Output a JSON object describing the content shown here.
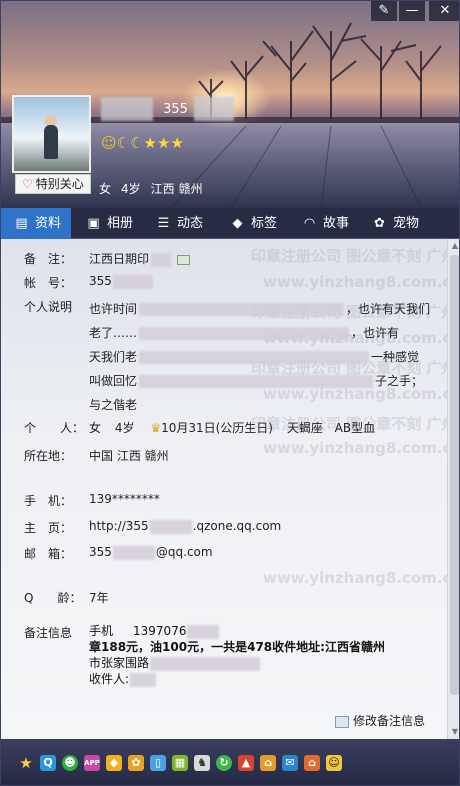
{
  "window_buttons": {
    "skin": "✎",
    "minimize": "—",
    "close": "✕"
  },
  "profile": {
    "nickname_visible": "355",
    "special_care": "特别关心",
    "gender": "女",
    "age": "4岁",
    "province": "江西",
    "city": "赣州",
    "level_icons": [
      "sun-icon",
      "moon-icon",
      "moon-icon",
      "star-icon",
      "star-icon",
      "star-icon"
    ]
  },
  "tabs": [
    {
      "label": "资料",
      "icon": "profile-card-icon"
    },
    {
      "label": "相册",
      "icon": "album-icon"
    },
    {
      "label": "动态",
      "icon": "feed-icon"
    },
    {
      "label": "标签",
      "icon": "tag-icon"
    },
    {
      "label": "故事",
      "icon": "story-icon"
    },
    {
      "label": "宠物",
      "icon": "pet-icon"
    }
  ],
  "watermarks": [
    "www.yinzhang8.com.cn",
    "印章注册公司 图公章不刻 广州",
    "www.yinzhang8.com.cn",
    "印章注册公司 图公章不刻 广州",
    "www.yinzhang8.com.cn",
    "印章注册公司 图公章不刻 广州",
    "www.yinzhang8.com.cn",
    "印章注册公司 图公章不刻 广州",
    "www.yinzhang8.com.cn"
  ],
  "fields": {
    "remark": {
      "label": "备　注：",
      "value": "江西日期印"
    },
    "account": {
      "label": "帐　号：",
      "value": "355"
    },
    "bio": {
      "label": "个人说明",
      "lines": [
        [
          "也许时间",
          "",
          "，也许有天我们"
        ],
        [
          "老了……",
          "",
          "，也许有"
        ],
        [
          "天我们老",
          "",
          "一种感觉"
        ],
        [
          "叫做回忆",
          "",
          "子之手；"
        ],
        [
          "与之偕老",
          "",
          ""
        ]
      ]
    },
    "personal": {
      "label": "个　　人：",
      "gender": "女",
      "age": "4岁",
      "birthday": "10月31日(公历生日)",
      "zodiac": "天蝎座",
      "blood": "AB型血"
    },
    "location": {
      "label": "所在地：",
      "value": "中国 江西 赣州"
    },
    "mobile": {
      "label": "手　机：",
      "value": "139********"
    },
    "homepage": {
      "label": "主　页：",
      "prefix": "http://355",
      ".suffix": "",
      "suffix": ".qzone.qq.com"
    },
    "email": {
      "label": "邮　箱：",
      "prefix": "355",
      "suffix": "@qq.com"
    },
    "qage": {
      "label": "Q　　龄：",
      "value": "7年"
    },
    "note_info": {
      "label": "备注信息",
      "phone_label": "手机",
      "phone": "1397076",
      "line2": "章188元，油100元，一共是478收件地址:江西省赣州",
      "line3": "市张家围路",
      "line4": "收件人:"
    }
  },
  "edit_note": "修改备注信息",
  "bottom_apps": [
    "star-icon",
    "qzone-icon",
    "wechat-icon",
    "app-icon",
    "gift-icon",
    "game-icon",
    "phone-icon",
    "box-icon",
    "pet-icon",
    "refresh-icon",
    "shop-icon",
    "house-icon",
    "mail-icon",
    "home-icon",
    "penguin-icon"
  ]
}
